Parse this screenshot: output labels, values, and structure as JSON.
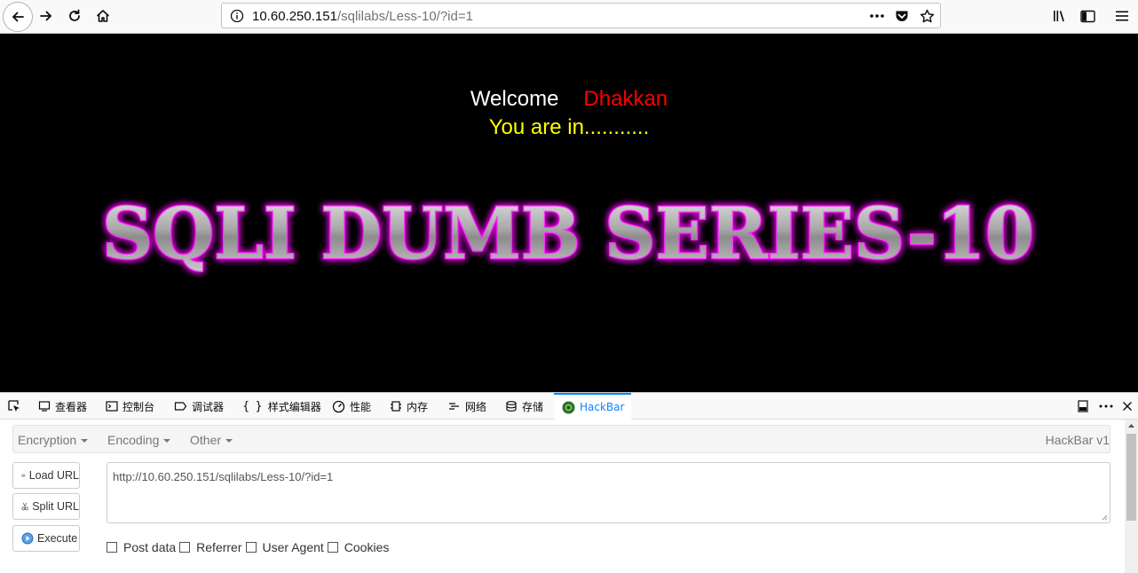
{
  "browser": {
    "url_host": "10.60.250.151",
    "url_path": "/sqlilabs/Less-10/?id=1",
    "icons": [
      "back-icon",
      "forward-icon",
      "reload-icon",
      "home-icon",
      "info-icon",
      "more-icon",
      "pocket-icon",
      "bookmark-star-icon",
      "library-icon",
      "sidebar-icon",
      "menu-icon"
    ]
  },
  "page": {
    "welcome": "Welcome",
    "user": "Dhakkan",
    "status": "You are in...........",
    "banner": "SQLI DUMB SERIES-10",
    "colors": {
      "background": "#000000",
      "welcome": "#ffffff",
      "user": "#ff0000",
      "status": "#ffff00",
      "banner_glow": "#e000e0"
    }
  },
  "devtools": {
    "tabs": [
      {
        "label": "查看器",
        "icon": "inspector-icon"
      },
      {
        "label": "控制台",
        "icon": "console-icon"
      },
      {
        "label": "调试器",
        "icon": "debugger-icon"
      },
      {
        "label": "样式编辑器",
        "icon": "style-editor-icon"
      },
      {
        "label": "性能",
        "icon": "performance-icon"
      },
      {
        "label": "内存",
        "icon": "memory-icon"
      },
      {
        "label": "网络",
        "icon": "network-icon"
      },
      {
        "label": "存储",
        "icon": "storage-icon"
      },
      {
        "label": "HackBar",
        "icon": "hackbar-icon"
      }
    ],
    "active_tab": "HackBar"
  },
  "hackbar": {
    "menus": [
      "Encryption",
      "Encoding",
      "Other"
    ],
    "version": "HackBar v1",
    "buttons": [
      {
        "label": "Load URL",
        "icon": "load-url-icon"
      },
      {
        "label": "Split URL",
        "icon": "split-url-icon"
      },
      {
        "label": "Execute",
        "icon": "execute-icon"
      }
    ],
    "url_value": "http://10.60.250.151/sqlilabs/Less-10/?id=1",
    "options": [
      {
        "label": "Post data",
        "checked": false
      },
      {
        "label": "Referrer",
        "checked": false
      },
      {
        "label": "User Agent",
        "checked": false
      },
      {
        "label": "Cookies",
        "checked": false
      }
    ]
  }
}
